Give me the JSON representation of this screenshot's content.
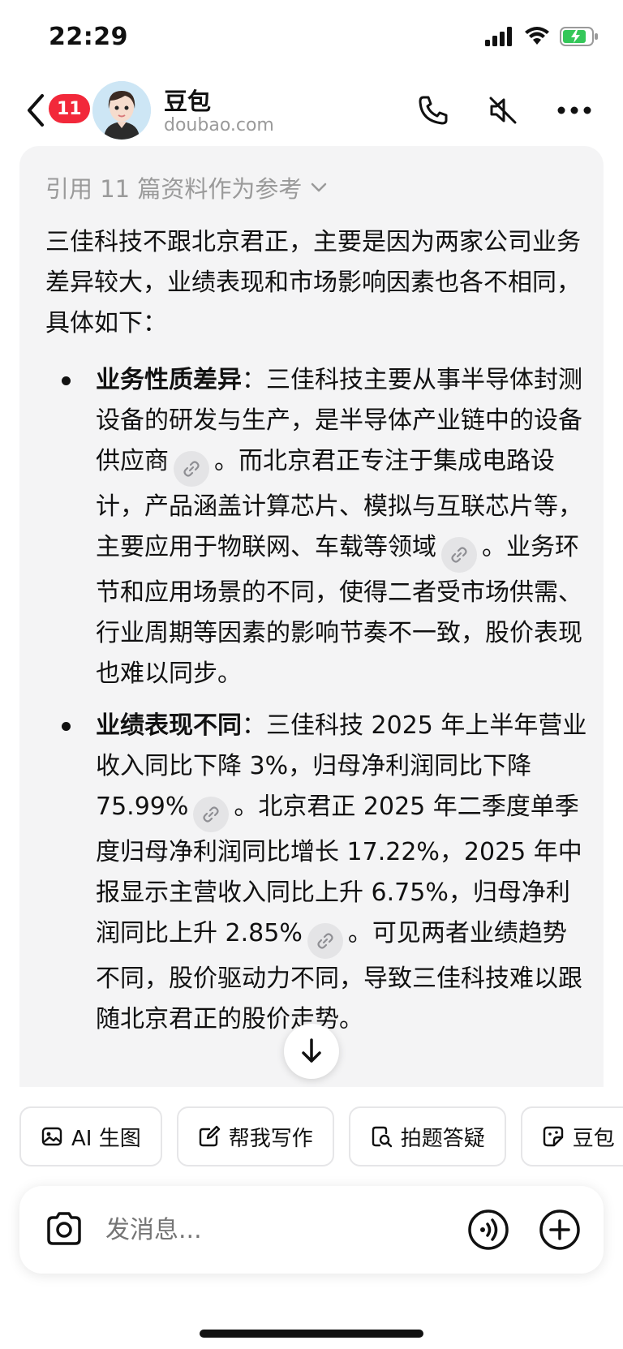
{
  "status_bar": {
    "time": "22:29"
  },
  "header": {
    "unread_count": "11",
    "bot_name": "豆包",
    "bot_site": "doubao.com"
  },
  "message": {
    "citation": "引用 11 篇资料作为参考",
    "intro": "三佳科技不跟北京君正，主要是因为两家公司业务差异较大，业绩表现和市场影响因素也各不相同，具体如下：",
    "bullets": [
      {
        "title": "业务性质差异",
        "t1": "：三佳科技主要从事半导体封测设备的研发与生产，是半导体产业链中的设备供应商",
        "t2": "。而北京君正专注于集成电路设计，产品涵盖计算芯片、模拟与互联芯片等，主要应用于物联网、车载等领域",
        "t3": "。业务环节和应用场景的不同，使得二者受市场供需、行业周期等因素的影响节奏不一致，股价表现也难以同步。"
      },
      {
        "title": "业绩表现不同",
        "t1": "：三佳科技 2025 年上半年营业收入同比下降 3%，归母净利润同比下降 75.99%",
        "t2": "。北京君正 2025 年二季度单季度归母净利润同比增长 17.22%，2025 年中报显示主营收入同比上升 6.75%，归母净利润同比上升 2.85%",
        "t3": "。可见两者业绩趋势不同，股价驱动力不同，导致三佳科技难以跟随北京君正的股价走势。"
      }
    ]
  },
  "quick_actions": [
    {
      "label": "AI 生图",
      "icon": "image-icon"
    },
    {
      "label": "帮我写作",
      "icon": "edit-icon"
    },
    {
      "label": "拍题答疑",
      "icon": "search-doc-icon"
    },
    {
      "label": "豆包",
      "icon": "sticker-icon"
    }
  ],
  "input": {
    "placeholder": "发消息..."
  }
}
